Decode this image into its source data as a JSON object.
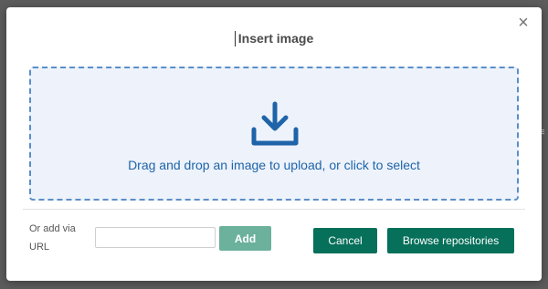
{
  "dialog": {
    "title": "Insert image",
    "close_symbol": "×",
    "close_icon": "close-icon"
  },
  "dropzone": {
    "icon": "download-icon",
    "text": "Drag and drop an image to upload, or click to select"
  },
  "url": {
    "label": "Or add via URL",
    "value": "",
    "add_label": "Add"
  },
  "footer": {
    "cancel_label": "Cancel",
    "browse_label": "Browse repositories"
  },
  "colors": {
    "accent": "#06705a",
    "accent_disabled": "#6bb19c",
    "dropzone_border": "#5a8ec7",
    "dropzone_bg": "#edf2fb",
    "dropzone_text": "#1f64a8"
  }
}
